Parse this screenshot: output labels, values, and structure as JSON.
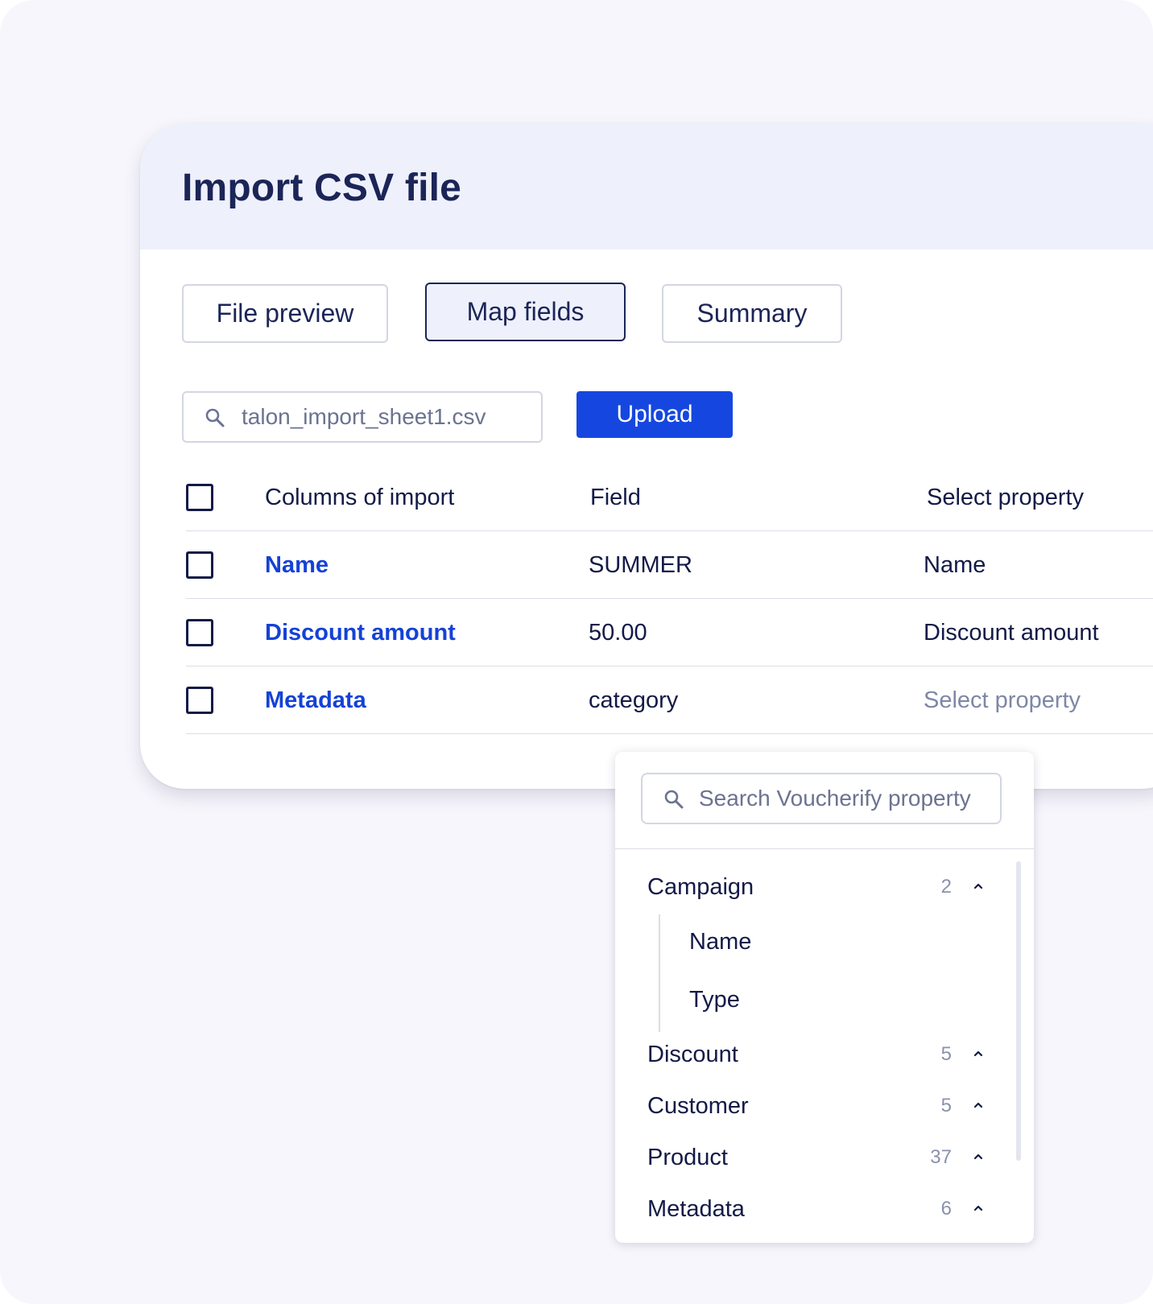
{
  "dialog": {
    "title": "Import CSV file"
  },
  "tabs": [
    {
      "label": "File preview",
      "active": false
    },
    {
      "label": "Map fields",
      "active": true
    },
    {
      "label": "Summary",
      "active": false
    }
  ],
  "file_input": {
    "value": "talon_import_sheet1.csv",
    "icon": "search-icon"
  },
  "upload_button": {
    "label": "Upload"
  },
  "table": {
    "headers": [
      "Columns of import",
      "Field",
      "Select property"
    ],
    "rows": [
      {
        "column": "Name",
        "field": "SUMMER",
        "property": "Name"
      },
      {
        "column": "Discount amount",
        "field": "50.00",
        "property": "Discount amount"
      },
      {
        "column": "Metadata",
        "field": "category",
        "property": "Select property"
      }
    ]
  },
  "dropdown": {
    "search_placeholder": "Search Voucherify property",
    "groups": [
      {
        "label": "Campaign",
        "count": "2",
        "expanded": true,
        "children": [
          "Name",
          "Type"
        ]
      },
      {
        "label": "Discount",
        "count": "5"
      },
      {
        "label": "Customer",
        "count": "5"
      },
      {
        "label": "Product",
        "count": "37"
      },
      {
        "label": "Metadata",
        "count": "6"
      }
    ]
  },
  "colors": {
    "primary": "#1547e0",
    "link": "#1442d6",
    "text": "#131a47",
    "header_bg": "#eef1fc",
    "page_bg": "#f7f6fc"
  }
}
